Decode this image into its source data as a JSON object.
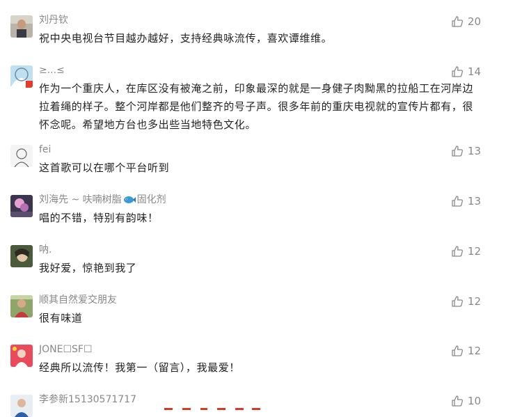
{
  "comments": [
    {
      "nickname": "刘丹钦",
      "text": "祝中央电视台节目越办越好，支持经典咏流传，喜欢谭维维。",
      "likes": "20"
    },
    {
      "nickname": "≥...≤",
      "text": "作为一个重庆人，在库区没有被淹之前，印象最深的就是一身健子肉黝黑的拉船工在河岸边拉着绳的样子。整个河岸都是他们整齐的号子声。很多年前的重庆电视就的宣传片都有，很怀念呢。希望地方台也多出些当地特色文化。",
      "likes": "14"
    },
    {
      "nickname": "fei",
      "text": "这首歌可以在哪个平台听到",
      "likes": "13"
    },
    {
      "nickname_parts": [
        "刘海先 ~ 呋喃树脂",
        "固化剂"
      ],
      "text": "唱的不错，特别有韵味！",
      "likes": "13"
    },
    {
      "nickname": "呐.",
      "text": "我好爱，惊艳到我了",
      "likes": "12"
    },
    {
      "nickname": "顺其自然爱交朋友",
      "text": "很有味道",
      "likes": "12"
    },
    {
      "nickname": "JONE☐SF☐",
      "text": "经典所以流传！我第一（留言），我最爱！",
      "likes": "12"
    },
    {
      "nickname": "李参新15130571717",
      "text": "",
      "likes": "10"
    }
  ],
  "icons": {
    "like": "thumbs-up-icon",
    "fish": "fish-emoji-icon"
  },
  "colors": {
    "text": "#222222",
    "meta": "#888888",
    "background": "#ffffff"
  }
}
